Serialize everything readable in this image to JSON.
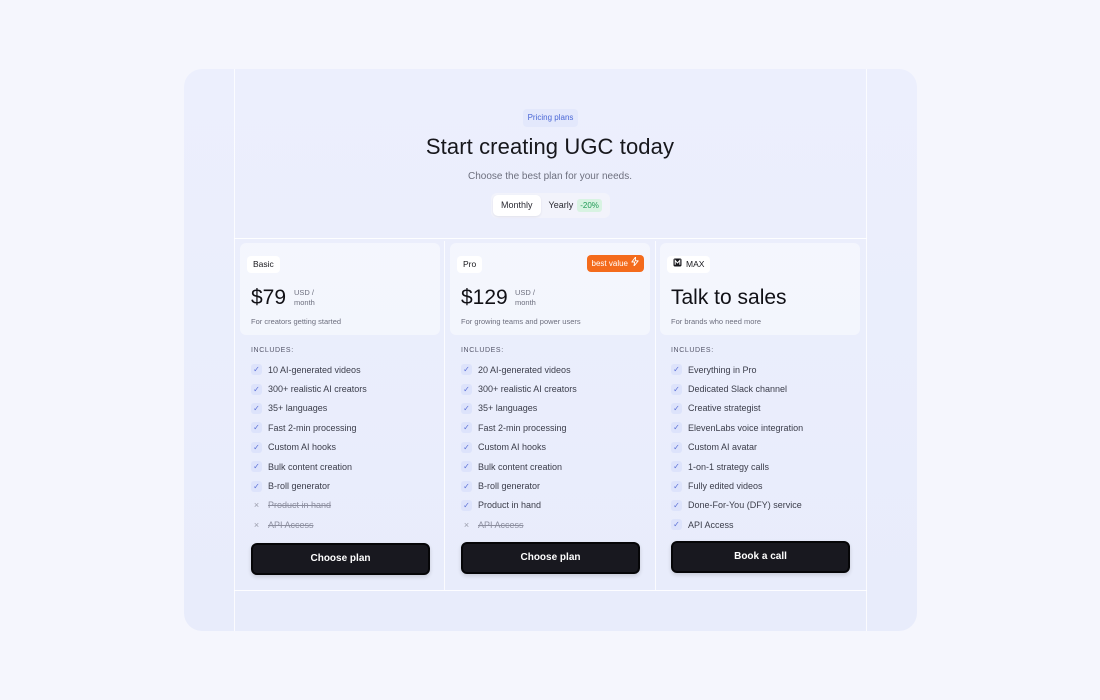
{
  "header": {
    "badge": "Pricing plans",
    "title": "Start creating UGC today",
    "subtitle": "Choose the best plan for your needs."
  },
  "billing_toggle": {
    "monthly": "Monthly",
    "yearly": "Yearly",
    "discount": "-20%",
    "selected": "Monthly"
  },
  "plans": [
    {
      "name": "Basic",
      "price": "$79",
      "unit_line1": "USD /",
      "unit_line2": "month",
      "description": "For creators getting started",
      "includes_label": "INCLUDES:",
      "features": [
        {
          "text": "10 AI-generated videos",
          "included": true
        },
        {
          "text": "300+ realistic AI creators",
          "included": true
        },
        {
          "text": "35+ languages",
          "included": true
        },
        {
          "text": "Fast 2-min processing",
          "included": true
        },
        {
          "text": "Custom AI hooks",
          "included": true
        },
        {
          "text": "Bulk content creation",
          "included": true
        },
        {
          "text": "B-roll generator",
          "included": true
        },
        {
          "text": "Product in hand",
          "included": false
        },
        {
          "text": "API Access",
          "included": false
        }
      ],
      "cta": "Choose plan"
    },
    {
      "name": "Pro",
      "badge": "best value",
      "price": "$129",
      "unit_line1": "USD /",
      "unit_line2": "month",
      "description": "For growing teams and power users",
      "includes_label": "INCLUDES:",
      "features": [
        {
          "text": "20 AI-generated videos",
          "included": true
        },
        {
          "text": "300+ realistic AI creators",
          "included": true
        },
        {
          "text": "35+ languages",
          "included": true
        },
        {
          "text": "Fast 2-min processing",
          "included": true
        },
        {
          "text": "Custom AI hooks",
          "included": true
        },
        {
          "text": "Bulk content creation",
          "included": true
        },
        {
          "text": "B-roll generator",
          "included": true
        },
        {
          "text": "Product in hand",
          "included": true
        },
        {
          "text": "API Access",
          "included": false
        }
      ],
      "cta": "Choose plan"
    },
    {
      "name": "MAX",
      "price": "Talk to sales",
      "description": "For brands who need more",
      "includes_label": "INCLUDES:",
      "features": [
        {
          "text": "Everything in Pro",
          "included": true
        },
        {
          "text": "Dedicated Slack channel",
          "included": true
        },
        {
          "text": "Creative strategist",
          "included": true
        },
        {
          "text": "ElevenLabs voice integration",
          "included": true
        },
        {
          "text": "Custom AI avatar",
          "included": true
        },
        {
          "text": "1-on-1 strategy calls",
          "included": true
        },
        {
          "text": "Fully edited videos",
          "included": true
        },
        {
          "text": "Done-For-You (DFY) service",
          "included": true
        },
        {
          "text": "API Access",
          "included": true
        }
      ],
      "cta": "Book a call"
    }
  ],
  "colors": {
    "accent": "#f46b1c",
    "cta_bg": "#18181f",
    "check_bg": "#dde3fb",
    "discount_green": "#1f9a55"
  }
}
